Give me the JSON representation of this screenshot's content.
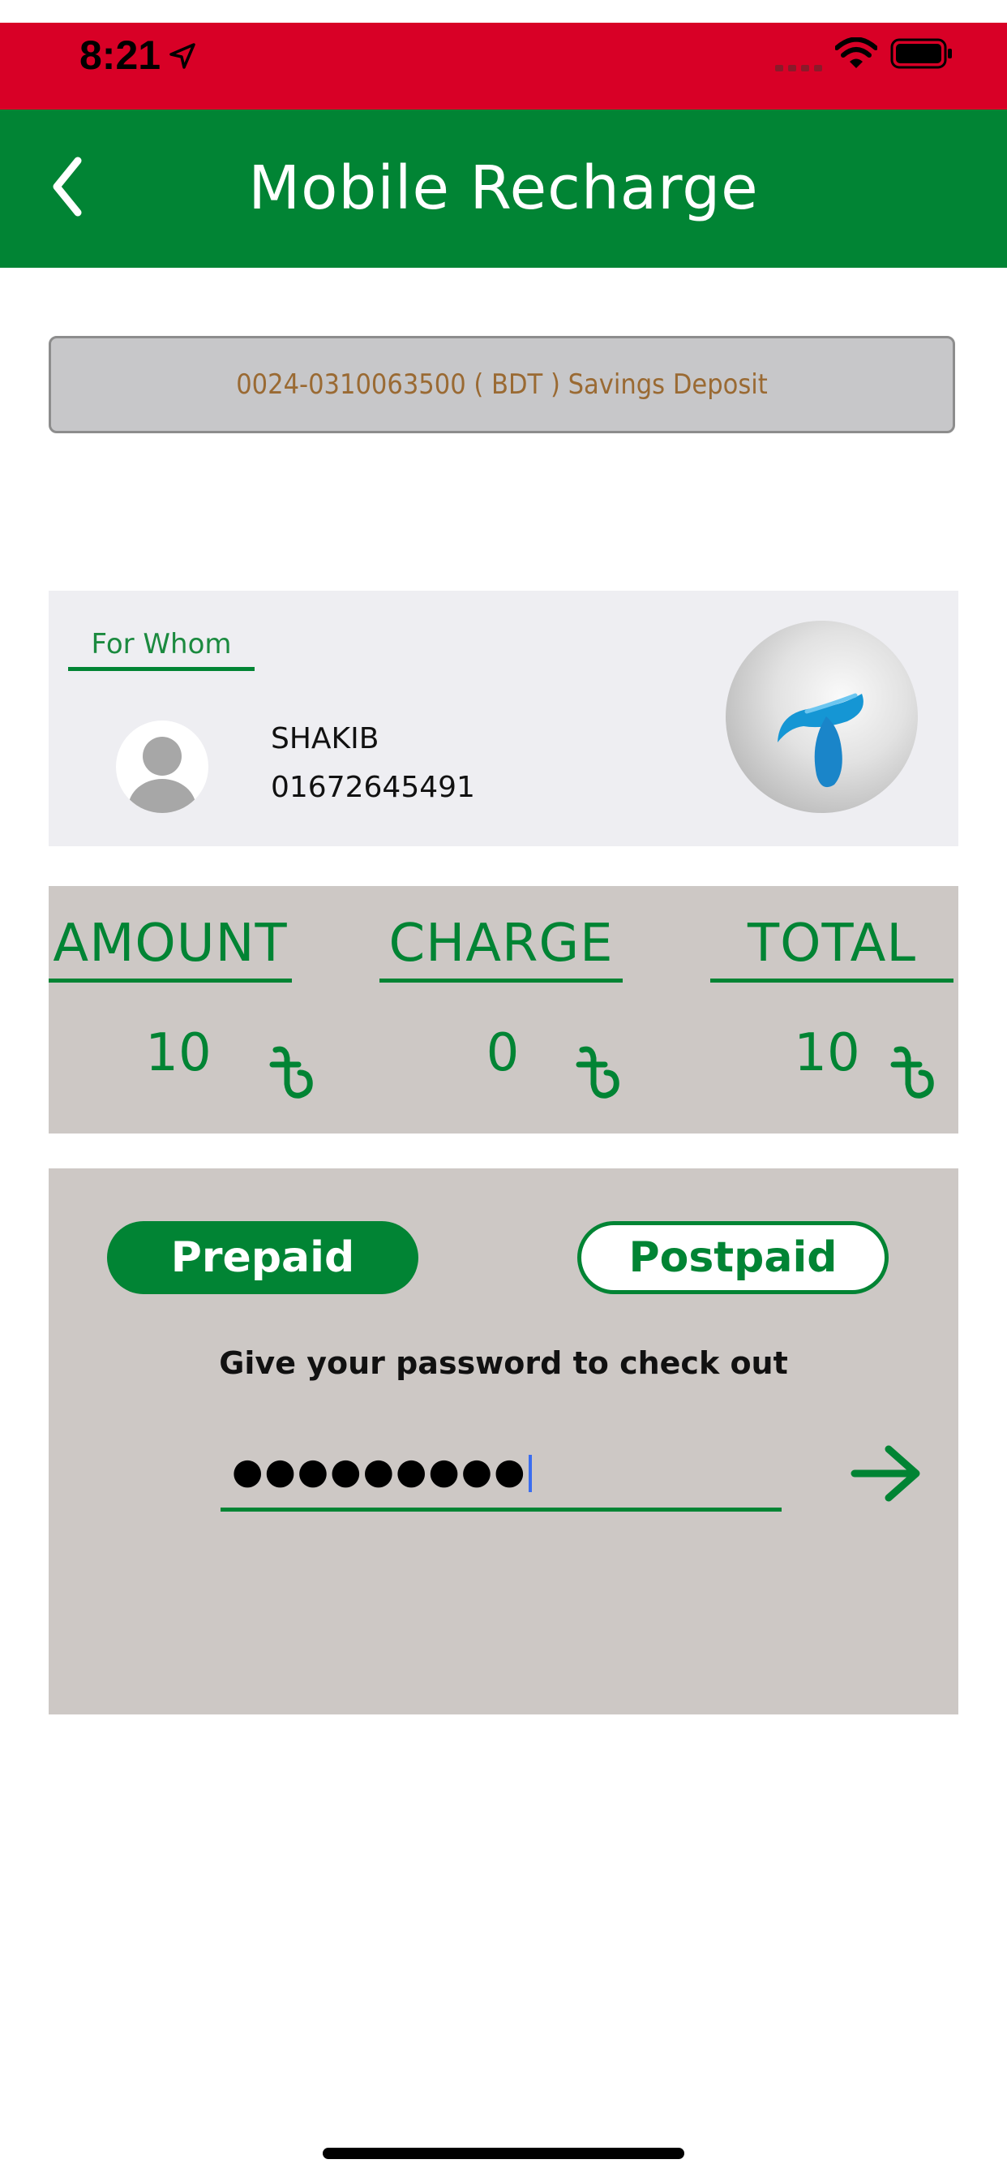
{
  "status_bar": {
    "time": "8:21"
  },
  "header": {
    "title": "Mobile Recharge"
  },
  "account": {
    "selected": "0024-0310063500 ( BDT )  Savings Deposit"
  },
  "recipient": {
    "tab_label": "For Whom",
    "name": "SHAKIB",
    "phone": "01672645491"
  },
  "summary": {
    "amount_label": "AMOUNT",
    "charge_label": "CHARGE",
    "total_label": "TOTAL",
    "amount_value": "10",
    "charge_value": "0",
    "total_value": "10"
  },
  "checkout": {
    "prepaid_label": "Prepaid",
    "postpaid_label": "Postpaid",
    "prompt": "Give your password to check out",
    "password_masked": "●●●●●●●●●"
  },
  "colors": {
    "status_bar": "#d80026",
    "brand_green": "#018434",
    "card_gray": "#cdc8c5",
    "account_text": "#9a6a33"
  },
  "icons": {
    "back": "chevron-left-icon",
    "currency": "taka-icon",
    "submit": "arrow-right-icon",
    "operator": "grameenphone-logo"
  }
}
